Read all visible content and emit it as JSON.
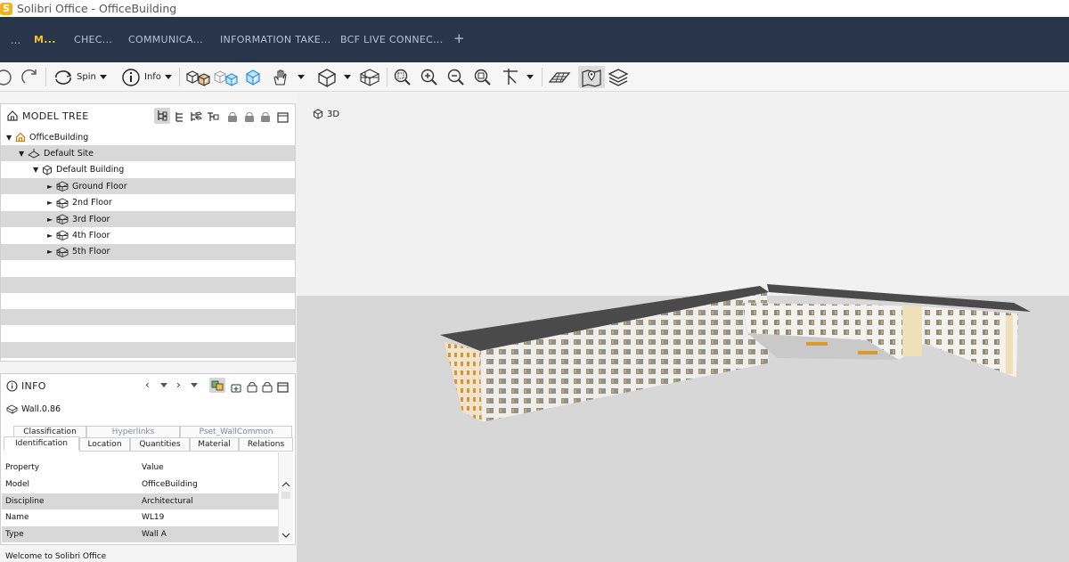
{
  "window": {
    "app_logo": "S",
    "title": "Solibri Office - OfficeBuilding"
  },
  "layout_tabs": {
    "more": "...",
    "model": "M...",
    "check": "CHEC...",
    "communication": "COMMUNICA...",
    "information_takeoff": "INFORMATION TAKE...",
    "bcf_live": "BCF LIVE CONNEC...",
    "add": "+"
  },
  "toolbar": {
    "spin_label": "Spin",
    "info_label": "Info"
  },
  "model_tree": {
    "title": "MODEL TREE",
    "items": [
      {
        "label": "OfficeBuilding",
        "level": 0,
        "expanded": true,
        "icon": "model-icon"
      },
      {
        "label": "Default Site",
        "level": 1,
        "expanded": true,
        "icon": "site-icon"
      },
      {
        "label": "Default Building",
        "level": 2,
        "expanded": true,
        "icon": "building-icon"
      },
      {
        "label": "Ground Floor",
        "level": 3,
        "expanded": false,
        "icon": "floor-icon"
      },
      {
        "label": "2nd Floor",
        "level": 3,
        "expanded": false,
        "icon": "floor-icon"
      },
      {
        "label": "3rd Floor",
        "level": 3,
        "expanded": false,
        "icon": "floor-icon"
      },
      {
        "label": "4th Floor",
        "level": 3,
        "expanded": false,
        "icon": "floor-icon"
      },
      {
        "label": "5th Floor",
        "level": 3,
        "expanded": false,
        "icon": "floor-icon"
      }
    ]
  },
  "view3d": {
    "label": "3D"
  },
  "info": {
    "title": "INFO",
    "selected": "Wall.0.86",
    "tabs_back": [
      "Classification",
      "Hyperlinks",
      "Pset_WallCommon"
    ],
    "tabs_front": [
      "Identification",
      "Location",
      "Quantities",
      "Material",
      "Relations"
    ],
    "active_tab": "Identification",
    "columns": {
      "property": "Property",
      "value": "Value"
    },
    "rows": [
      {
        "property": "Model",
        "value": "OfficeBuilding"
      },
      {
        "property": "Discipline",
        "value": "Architectural"
      },
      {
        "property": "Name",
        "value": "WL19"
      },
      {
        "property": "Type",
        "value": "Wall A"
      }
    ]
  },
  "status": {
    "message": "Welcome to Solibri Office"
  },
  "colors": {
    "tabbar_bg": "#29354b",
    "active_tab": "#f5c231",
    "accent_blue": "#2a8fd6"
  }
}
